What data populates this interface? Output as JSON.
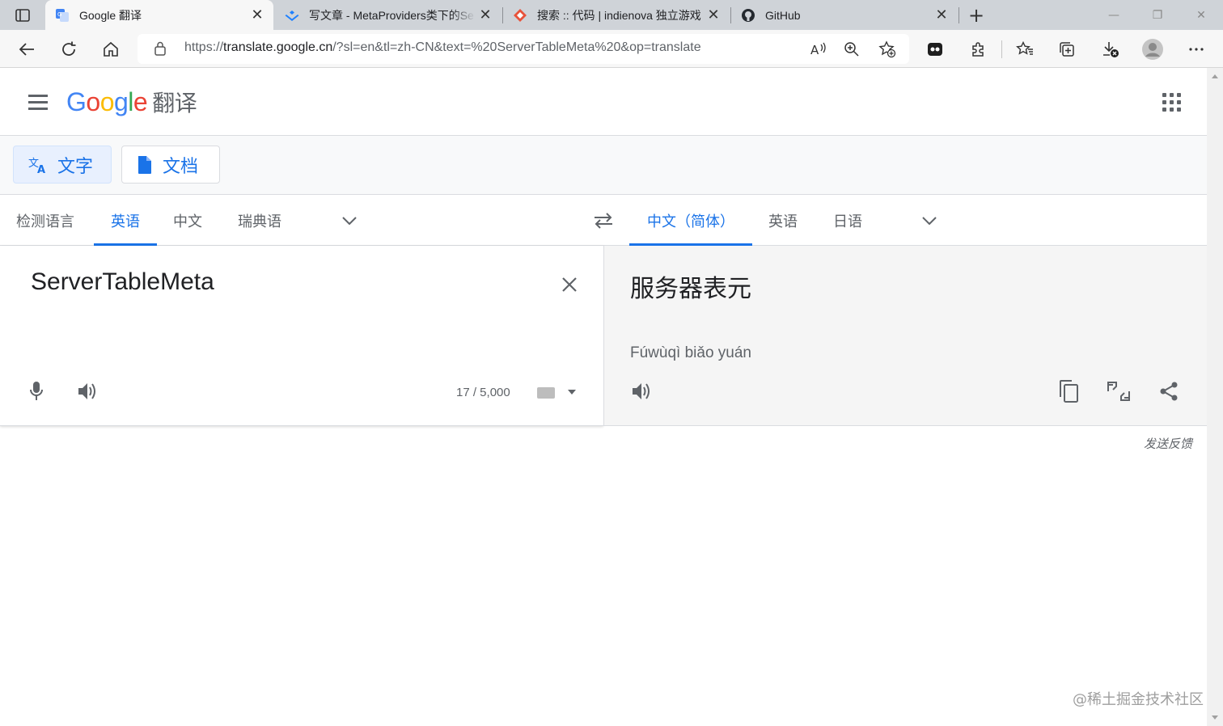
{
  "browser": {
    "tabs": [
      {
        "title": "Google 翻译",
        "icon": "google-translate-icon",
        "active": true
      },
      {
        "title": "写文章 - MetaProviders类下的Se",
        "icon": "juejin-icon",
        "active": false
      },
      {
        "title": "搜索 :: 代码 | indienova 独立游戏",
        "icon": "indienova-icon",
        "active": false
      },
      {
        "title": "GitHub",
        "icon": "github-icon",
        "active": false
      }
    ],
    "new_tab": "+",
    "close": "✕",
    "minimize": "—",
    "restore": "❐",
    "win_close": "✕",
    "url_prefix": "https://",
    "url_host": "translate.google.cn",
    "url_rest": "/?sl=en&tl=zh-CN&text=%20ServerTableMeta%20&op=translate"
  },
  "header": {
    "logo": "Google",
    "logo_suffix": "翻译"
  },
  "modes": [
    {
      "label": "文字",
      "icon": "translate-text-icon",
      "active": true
    },
    {
      "label": "文档",
      "icon": "document-icon",
      "active": false
    }
  ],
  "source_langs": [
    "检测语言",
    "英语",
    "中文",
    "瑞典语"
  ],
  "target_langs": [
    "中文（简体）",
    "英语",
    "日语"
  ],
  "source": {
    "text": "ServerTableMeta",
    "counter": "17 / 5,000"
  },
  "target": {
    "text": "服务器表元",
    "transliteration": "Fúwùqì biǎo yuán"
  },
  "feedback": "发送反馈",
  "watermark": "@稀土掘金技术社区",
  "colors": {
    "accent": "#1a73e8",
    "google_blue": "#4285f4",
    "google_red": "#ea4335",
    "google_yellow": "#fbbc05",
    "google_green": "#34a853"
  }
}
